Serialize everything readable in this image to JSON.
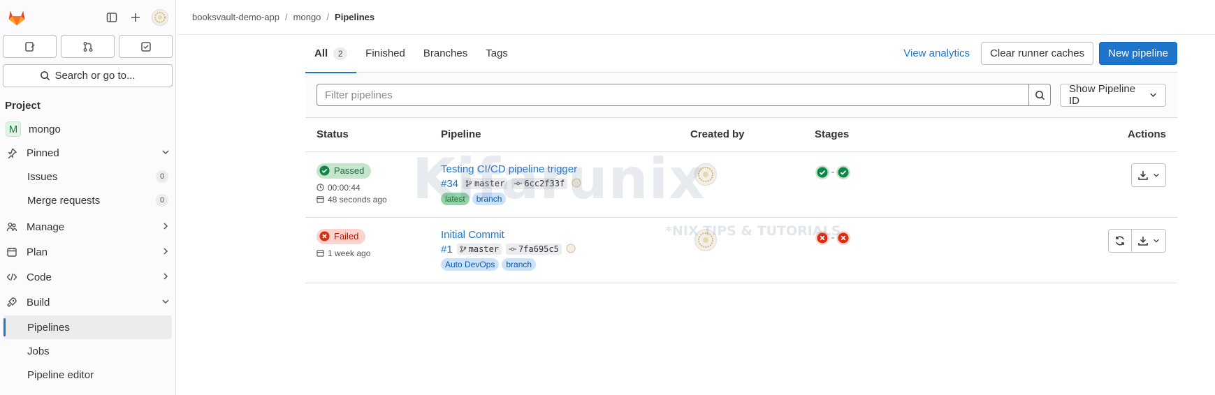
{
  "breadcrumb": {
    "items": [
      "booksvault-demo-app",
      "mongo"
    ],
    "current": "Pipelines"
  },
  "sidebar": {
    "search_label": "Search or go to...",
    "section_title": "Project",
    "project_initial": "M",
    "project_name": "mongo",
    "pinned_label": "Pinned",
    "issues_label": "Issues",
    "issues_count": "0",
    "mr_label": "Merge requests",
    "mr_count": "0",
    "manage_label": "Manage",
    "plan_label": "Plan",
    "code_label": "Code",
    "build_label": "Build",
    "pipelines_label": "Pipelines",
    "jobs_label": "Jobs",
    "pipeline_editor_label": "Pipeline editor"
  },
  "tabs": {
    "all_label": "All",
    "all_count": "2",
    "finished_label": "Finished",
    "branches_label": "Branches",
    "tags_label": "Tags"
  },
  "actions": {
    "analytics_label": "View analytics",
    "clear_label": "Clear runner caches",
    "new_label": "New pipeline"
  },
  "filter": {
    "placeholder": "Filter pipelines",
    "dropdown_label": "Show Pipeline ID"
  },
  "table": {
    "headers": {
      "status": "Status",
      "pipeline": "Pipeline",
      "created_by": "Created by",
      "stages": "Stages",
      "actions": "Actions"
    },
    "rows": [
      {
        "status": "Passed",
        "duration": "00:00:44",
        "finished": "48 seconds ago",
        "title": "Testing CI/CD pipeline trigger",
        "id": "#34",
        "branch": "master",
        "commit": "6cc2f33f",
        "chips": [
          "latest",
          "branch"
        ]
      },
      {
        "status": "Failed",
        "finished": "1 week ago",
        "title": "Initial Commit",
        "id": "#1",
        "branch": "master",
        "commit": "7fa695c5",
        "chips": [
          "Auto DevOps",
          "branch"
        ]
      }
    ]
  },
  "colors": {
    "accent": "#1f75cb",
    "success": "#108548",
    "danger": "#dd2b0e"
  },
  "watermark": {
    "main": "Kifarunix",
    "sub": "*NIX TIPS & TUTORIALS"
  }
}
